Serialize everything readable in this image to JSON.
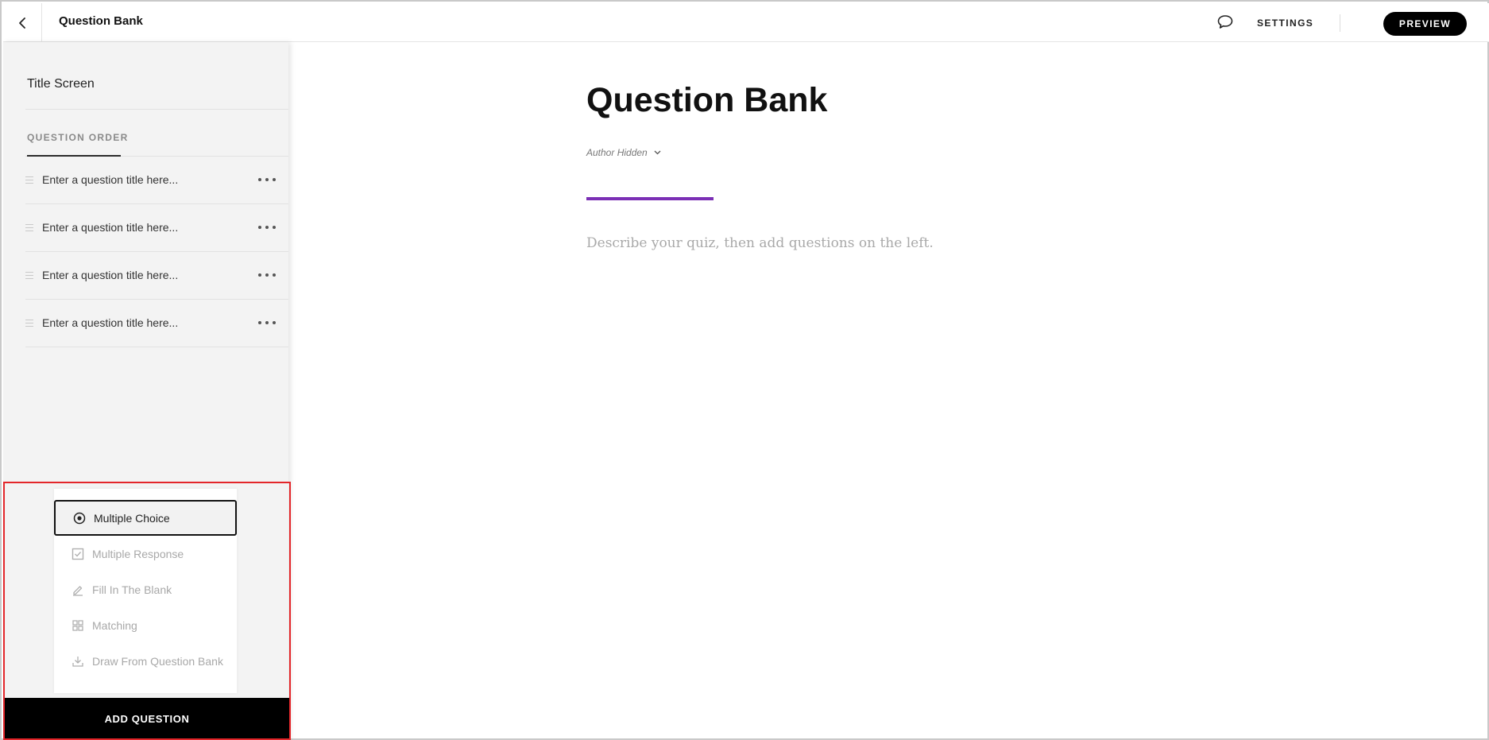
{
  "header": {
    "title": "Question Bank",
    "settings_label": "SETTINGS",
    "preview_label": "PREVIEW"
  },
  "sidebar": {
    "title_screen": "Title Screen",
    "question_order_label": "QUESTION ORDER",
    "questions": [
      {
        "title": "Enter a question title here..."
      },
      {
        "title": "Enter a question title here..."
      },
      {
        "title": "Enter a question title here..."
      },
      {
        "title": "Enter a question title here..."
      }
    ]
  },
  "add_menu": {
    "items": [
      {
        "label": "Multiple Choice",
        "icon": "radio-icon",
        "selected": true
      },
      {
        "label": "Multiple Response",
        "icon": "checkbox-icon",
        "selected": false
      },
      {
        "label": "Fill In The Blank",
        "icon": "pencil-icon",
        "selected": false
      },
      {
        "label": "Matching",
        "icon": "grid-icon",
        "selected": false
      },
      {
        "label": "Draw From Question Bank",
        "icon": "download-icon",
        "selected": false
      }
    ],
    "add_button_label": "ADD QUESTION"
  },
  "main": {
    "title": "Question Bank",
    "author": "Author Hidden",
    "description_placeholder": "Describe your quiz, then add questions on the left."
  },
  "colors": {
    "accent": "#7b2fb5",
    "highlight": "#e3262a",
    "primary_button": "#000000"
  }
}
